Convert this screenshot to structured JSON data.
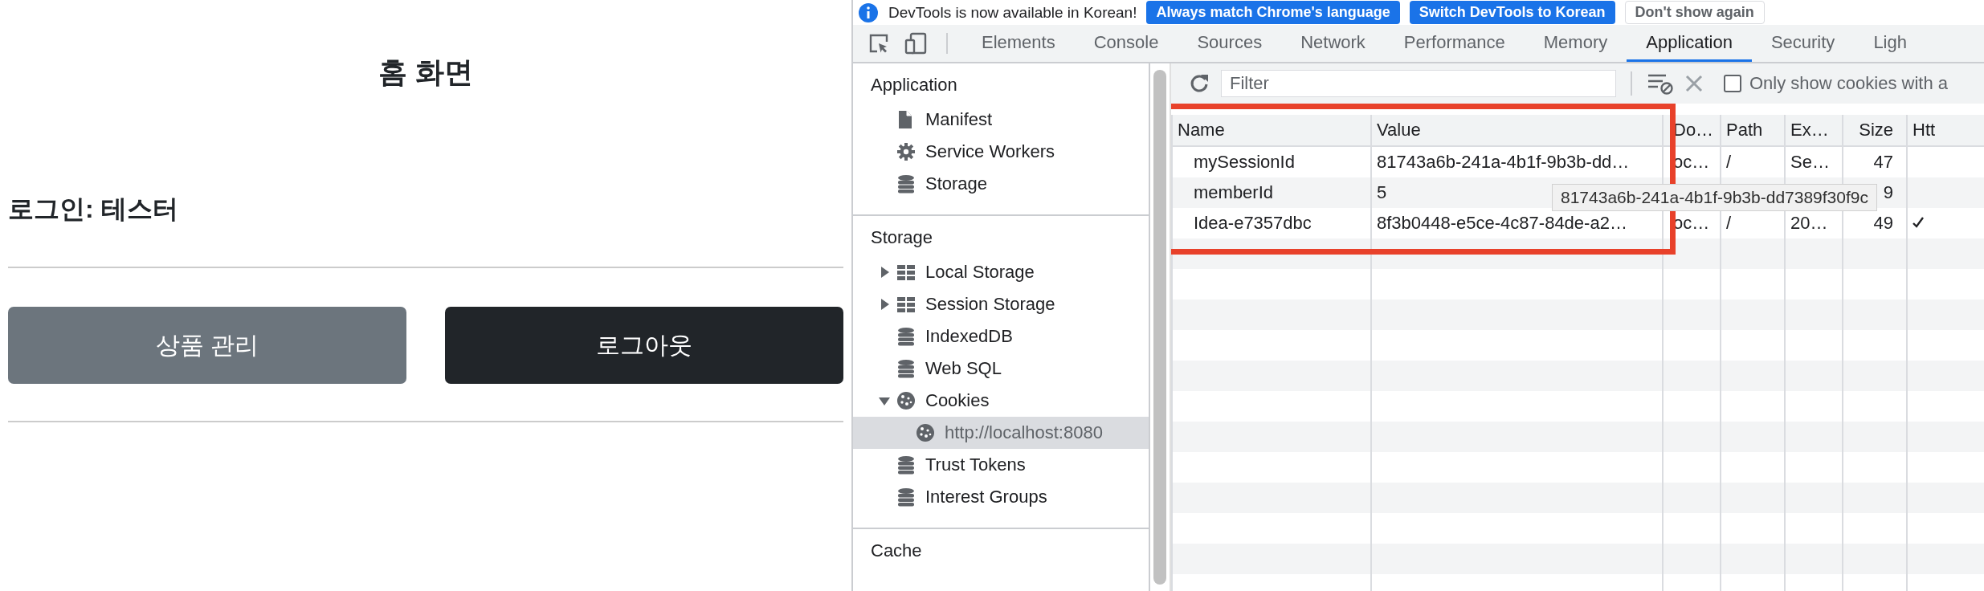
{
  "page": {
    "title": "홈 화면",
    "login_line": "로그인: 테스터",
    "buttons": [
      {
        "label": "상품 관리",
        "kind": "secondary"
      },
      {
        "label": "로그아웃",
        "kind": "dark"
      }
    ]
  },
  "devtools": {
    "banner": {
      "message": "DevTools is now available in Korean!",
      "buttons": [
        {
          "label": "Always match Chrome's language",
          "kind": "primary"
        },
        {
          "label": "Switch DevTools to Korean",
          "kind": "primary"
        },
        {
          "label": "Don't show again",
          "kind": "plain"
        }
      ]
    },
    "tabs": [
      {
        "label": "Elements",
        "selected": false
      },
      {
        "label": "Console",
        "selected": false
      },
      {
        "label": "Sources",
        "selected": false
      },
      {
        "label": "Network",
        "selected": false
      },
      {
        "label": "Performance",
        "selected": false
      },
      {
        "label": "Memory",
        "selected": false
      },
      {
        "label": "Application",
        "selected": true
      },
      {
        "label": "Security",
        "selected": false
      },
      {
        "label": "Ligh",
        "selected": false
      }
    ],
    "sidebar": {
      "sections": [
        {
          "title": "Application",
          "items": [
            {
              "label": "Manifest",
              "kind": "file",
              "selected": false
            },
            {
              "label": "Service Workers",
              "kind": "gear",
              "selected": false
            },
            {
              "label": "Storage",
              "kind": "database",
              "selected": false
            }
          ]
        },
        {
          "title": "Storage",
          "items": [
            {
              "label": "Local Storage",
              "kind": "table",
              "expanded": false,
              "selected": false
            },
            {
              "label": "Session Storage",
              "kind": "table",
              "expanded": false,
              "selected": false
            },
            {
              "label": "IndexedDB",
              "kind": "database",
              "selected": false
            },
            {
              "label": "Web SQL",
              "kind": "database",
              "selected": false
            },
            {
              "label": "Cookies",
              "kind": "cookie",
              "expanded": true,
              "selected": false,
              "children": [
                {
                  "label": "http://localhost:8080",
                  "kind": "cookie",
                  "selected": true
                }
              ]
            },
            {
              "label": "Trust Tokens",
              "kind": "database",
              "selected": false
            },
            {
              "label": "Interest Groups",
              "kind": "database",
              "selected": false
            }
          ]
        },
        {
          "title": "Cache"
        }
      ]
    },
    "toolbar": {
      "filter": {
        "placeholder": "Filter"
      },
      "only_show_cookies": {
        "label": "Only show cookies with a",
        "checked": false
      }
    },
    "table": {
      "columns": [
        {
          "label": "Name"
        },
        {
          "label": "Value"
        },
        {
          "label": "Do…"
        },
        {
          "label": "Path"
        },
        {
          "label": "Ex…"
        },
        {
          "label": "Size"
        },
        {
          "label": "Htt"
        }
      ],
      "rows": [
        {
          "cells": [
            "mySessionId",
            "81743a6b-241a-4b1f-9b3b-dd…",
            "oc…",
            "/",
            "Se…",
            "47"
          ],
          "http_only": false
        },
        {
          "cells": [
            "memberId",
            "5",
            null,
            null,
            null,
            "9"
          ],
          "http_only": false
        },
        {
          "cells": [
            "Idea-e7357dbc",
            "8f3b0448-e5ce-4c87-84de-a2…",
            "oc…",
            "/",
            "20…",
            "49"
          ],
          "http_only": true
        }
      ]
    },
    "tooltip": "81743a6b-241a-4b1f-9b3b-dd7389f30f9c"
  }
}
